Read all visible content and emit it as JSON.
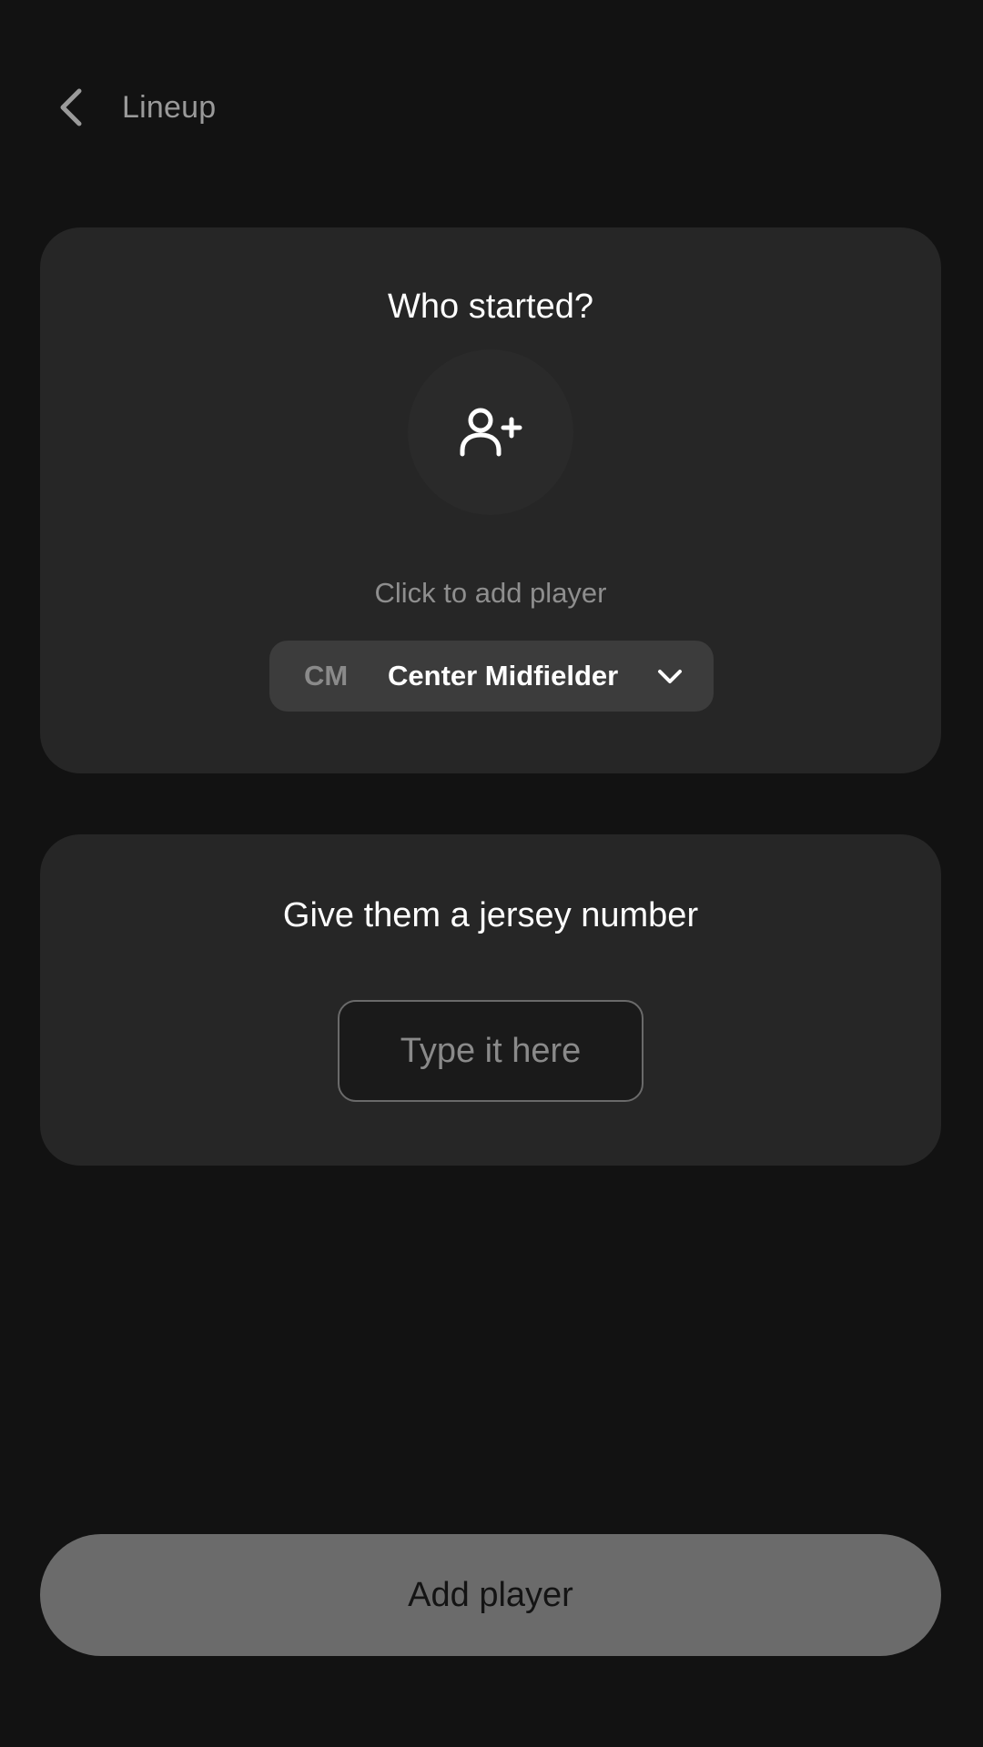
{
  "header": {
    "back_icon": "chevron-left-icon",
    "title": "Lineup"
  },
  "starter_card": {
    "title": "Who started?",
    "avatar_icon": "user-plus-icon",
    "hint": "Click to add player",
    "position": {
      "code": "CM",
      "name": "Center Midfielder",
      "dropdown_icon": "chevron-down-icon"
    }
  },
  "jersey_card": {
    "title": "Give them a jersey number",
    "input_value": "",
    "input_placeholder": "Type it here"
  },
  "footer": {
    "add_button_label": "Add player"
  },
  "colors": {
    "background": "#121212",
    "card": "#262626",
    "select": "#3c3c3c",
    "button_disabled": "#6b6b6b",
    "muted_text": "#8e8e8e"
  }
}
